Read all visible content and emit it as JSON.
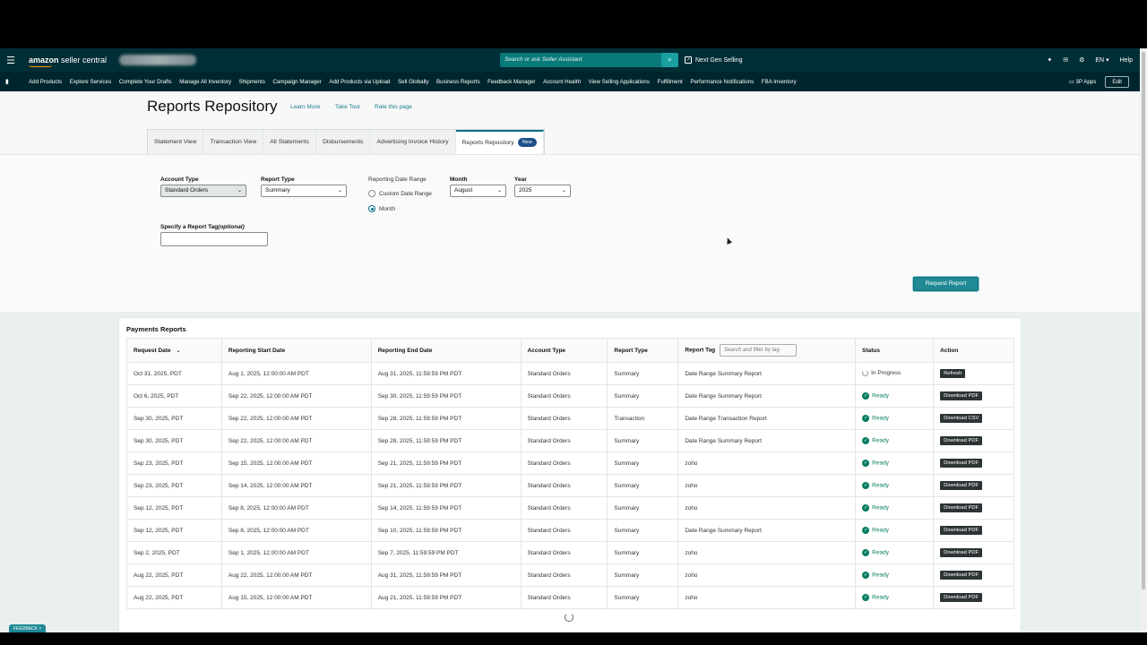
{
  "topbar": {
    "logo_brand": "amazon",
    "logo_suffix": "seller central",
    "search_placeholder": "Search or ask Seller Assistant",
    "next_gen": "Next Gen Selling",
    "lang": "EN",
    "help": "Help"
  },
  "nav": {
    "items": [
      "Add Products",
      "Explore Services",
      "Complete Your Drafts",
      "Manage All Inventory",
      "Shipments",
      "Campaign Manager",
      "Add Products via Upload",
      "Sell Globally",
      "Business Reports",
      "Feedback Manager",
      "Account Health",
      "View Selling Applications",
      "Fulfillment",
      "Performance Notifications",
      "FBA Inventory"
    ],
    "apps": "3P Apps",
    "edit": "Edit"
  },
  "header": {
    "title": "Reports Repository",
    "learn_more": "Learn More",
    "take_tour": "Take Tour",
    "rate": "Rate this page"
  },
  "tabs": [
    {
      "label": "Statement View"
    },
    {
      "label": "Transaction View"
    },
    {
      "label": "All Statements"
    },
    {
      "label": "Disbursements"
    },
    {
      "label": "Advertising Invoice History"
    },
    {
      "label": "Reports Repository",
      "badge": "New"
    }
  ],
  "form": {
    "account_type_label": "Account Type",
    "account_type_value": "Standard Orders",
    "report_type_label": "Report Type",
    "report_type_value": "Summary",
    "date_range_label": "Reporting Date Range",
    "custom_range": "Custom Date Range",
    "month_option": "Month",
    "month_label": "Month",
    "month_value": "August",
    "year_label": "Year",
    "year_value": "2025",
    "tag_label": "Specify a Report Tag",
    "tag_optional": "(optional)",
    "request_button": "Request Report"
  },
  "payments": {
    "title": "Payments Reports",
    "columns": [
      "Request Date",
      "Reporting Start Date",
      "Reporting End Date",
      "Account Type",
      "Report Type",
      "Report Tag",
      "Status",
      "Action"
    ],
    "tag_filter_placeholder": "Search and filter by tag",
    "rows": [
      {
        "request": "Oct 31, 2025, PDT",
        "start": "Aug 1, 2025, 12:00:00 AM PDT",
        "end": "Aug 31, 2025, 11:59:59 PM PDT",
        "account": "Standard Orders",
        "type": "Summary",
        "tag": "Date Range Summary Report",
        "status": "In Progress",
        "action": "Refresh"
      },
      {
        "request": "Oct 6, 2025, PDT",
        "start": "Sep 22, 2025, 12:00:00 AM PDT",
        "end": "Sep 30, 2025, 11:59:59 PM PDT",
        "account": "Standard Orders",
        "type": "Summary",
        "tag": "Date Range Summary Report",
        "status": "Ready",
        "action": "Download PDF"
      },
      {
        "request": "Sep 30, 2025, PDT",
        "start": "Sep 22, 2025, 12:00:00 AM PDT",
        "end": "Sep 28, 2025, 11:59:59 PM PDT",
        "account": "Standard Orders",
        "type": "Transaction",
        "tag": "Date Range Transaction Report",
        "status": "Ready",
        "action": "Download CSV"
      },
      {
        "request": "Sep 30, 2025, PDT",
        "start": "Sep 22, 2025, 12:00:00 AM PDT",
        "end": "Sep 28, 2025, 11:59:59 PM PDT",
        "account": "Standard Orders",
        "type": "Summary",
        "tag": "Date Range Summary Report",
        "status": "Ready",
        "action": "Download PDF"
      },
      {
        "request": "Sep 23, 2025, PDT",
        "start": "Sep 15, 2025, 12:00:00 AM PDT",
        "end": "Sep 21, 2025, 11:59:59 PM PDT",
        "account": "Standard Orders",
        "type": "Summary",
        "tag": "zoho",
        "status": "Ready",
        "action": "Download PDF"
      },
      {
        "request": "Sep 23, 2025, PDT",
        "start": "Sep 14, 2025, 12:00:00 AM PDT",
        "end": "Sep 21, 2025, 11:59:59 PM PDT",
        "account": "Standard Orders",
        "type": "Summary",
        "tag": "zoho",
        "status": "Ready",
        "action": "Download PDF"
      },
      {
        "request": "Sep 12, 2025, PDT",
        "start": "Sep 8, 2025, 12:00:00 AM PDT",
        "end": "Sep 14, 2025, 11:59:59 PM PDT",
        "account": "Standard Orders",
        "type": "Summary",
        "tag": "zoho",
        "status": "Ready",
        "action": "Download PDF"
      },
      {
        "request": "Sep 12, 2025, PDT",
        "start": "Sep 8, 2025, 12:00:00 AM PDT",
        "end": "Sep 10, 2025, 11:59:59 PM PDT",
        "account": "Standard Orders",
        "type": "Summary",
        "tag": "Date Range Summary Report",
        "status": "Ready",
        "action": "Download PDF"
      },
      {
        "request": "Sep 2, 2025, PDT",
        "start": "Sep 1, 2025, 12:00:00 AM PDT",
        "end": "Sep 7, 2025, 11:59:59 PM PDT",
        "account": "Standard Orders",
        "type": "Summary",
        "tag": "zoho",
        "status": "Ready",
        "action": "Download PDF"
      },
      {
        "request": "Aug 22, 2025, PDT",
        "start": "Aug 22, 2025, 12:00:00 AM PDT",
        "end": "Aug 31, 2025, 11:59:59 PM PDT",
        "account": "Standard Orders",
        "type": "Summary",
        "tag": "zoho",
        "status": "Ready",
        "action": "Download PDF"
      },
      {
        "request": "Aug 22, 2025, PDT",
        "start": "Aug 15, 2025, 12:00:00 AM PDT",
        "end": "Aug 21, 2025, 11:59:59 PM PDT",
        "account": "Standard Orders",
        "type": "Summary",
        "tag": "zoho",
        "status": "Ready",
        "action": "Download PDF"
      }
    ]
  },
  "feedback": "FEEDBACK ×",
  "colors": {
    "topbar": "#002e36",
    "navbar": "#00262d",
    "accent": "#007185",
    "ready": "#067d62",
    "button": "#1f8a95"
  }
}
